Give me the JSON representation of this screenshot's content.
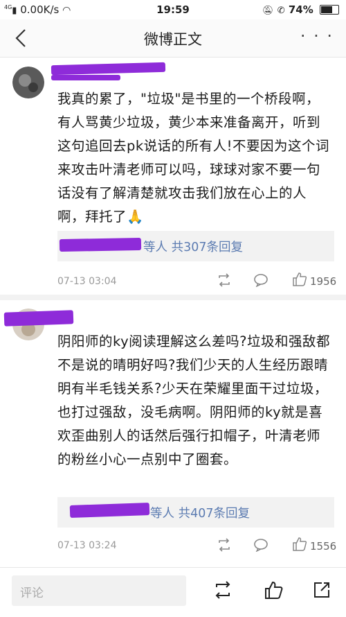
{
  "status_bar": {
    "network": "4G",
    "speed": "0.00K/s",
    "time": "19:59",
    "battery": "74%",
    "battery_level": 0.74
  },
  "header": {
    "title": "微博正文",
    "more": "· · ·"
  },
  "comments": [
    {
      "text": "我真的累了，\"垃圾\"是书里的一个桥段啊，有人骂黄少垃圾，黄少本来准备离开，听到这句追回去pk说话的所有人!不要因为这个词来攻击叶清老师可以吗，球球对家不要一句话没有了解清楚就攻击我们放在心上的人啊，拜托了🙏",
      "reply_summary": "等人 共307条回复",
      "time": "07-13 03:04",
      "likes": "1956"
    },
    {
      "text": "阴阳师的ky阅读理解这么差吗?垃圾和强敌都不是说的晴明好吗?我们少天的人生经历跟晴明有半毛钱关系?少天在荣耀里面干过垃圾，也打过强敌，没毛病啊。阴阳师的ky就是喜欢歪曲别人的话然后强行扣帽子，叶清老师的粉丝小心一点别中了圈套。",
      "reply_summary": "等人 共407条回复",
      "time": "07-13 03:24",
      "likes": "1556"
    }
  ],
  "bottom_bar": {
    "comment_placeholder": "评论"
  },
  "colors": {
    "redaction": "#8e2bd9",
    "link": "#5b7bb1"
  }
}
